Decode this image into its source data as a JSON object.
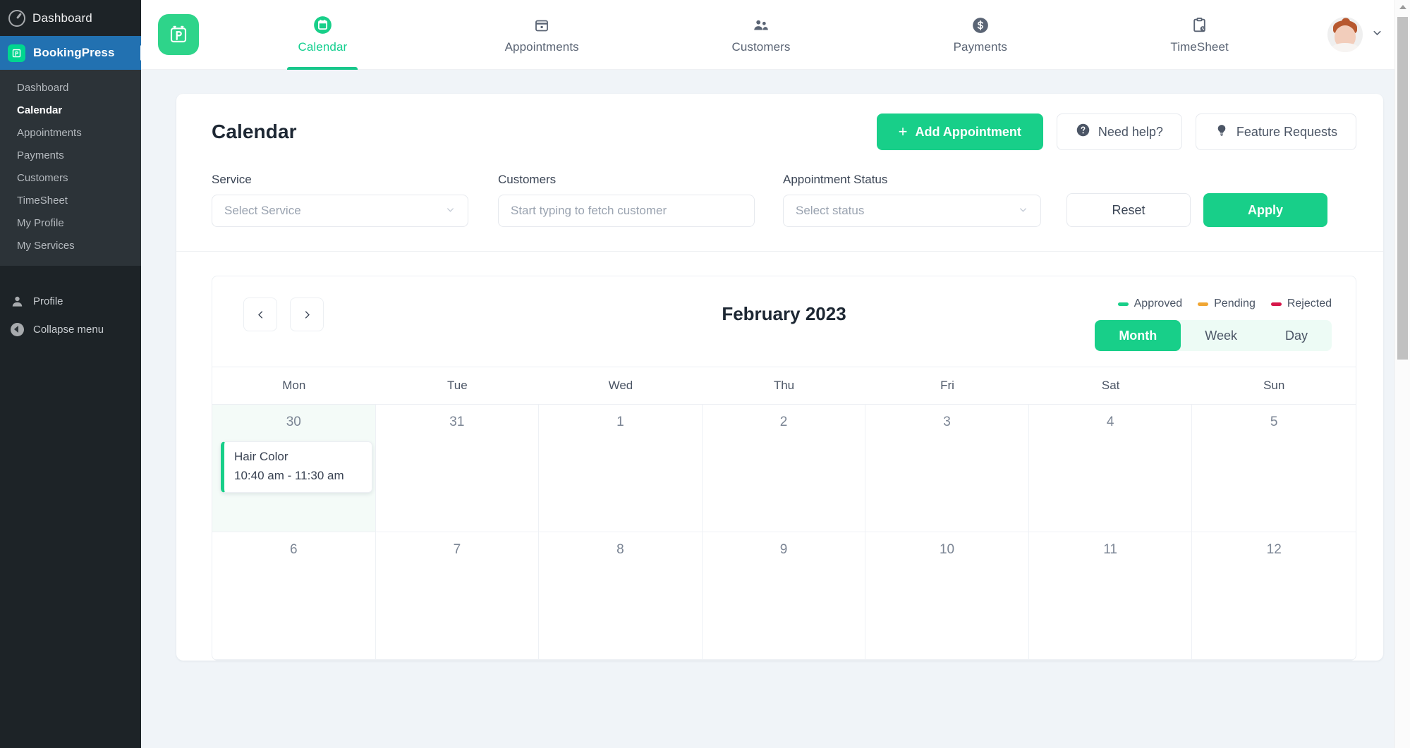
{
  "wp_admin": {
    "adminbar": {
      "label": "Dashboard",
      "icon": "dashboard-icon"
    },
    "brand": {
      "label": "BookingPress",
      "icon": "bookingpress-logo-icon"
    },
    "submenu": [
      {
        "label": "Dashboard",
        "current": false
      },
      {
        "label": "Calendar",
        "current": true
      },
      {
        "label": "Appointments",
        "current": false
      },
      {
        "label": "Payments",
        "current": false
      },
      {
        "label": "Customers",
        "current": false
      },
      {
        "label": "TimeSheet",
        "current": false
      },
      {
        "label": "My Profile",
        "current": false
      },
      {
        "label": "My Services",
        "current": false
      }
    ],
    "bottom": [
      {
        "label": "Profile",
        "icon": "user-icon"
      },
      {
        "label": "Collapse menu",
        "icon": "collapse-left-icon"
      }
    ]
  },
  "topnav": {
    "logo_icon": "bookingpress-app-logo",
    "items": [
      {
        "label": "Calendar",
        "icon": "calendar-filled-icon",
        "active": true
      },
      {
        "label": "Appointments",
        "icon": "calendar-outline-icon",
        "active": false
      },
      {
        "label": "Customers",
        "icon": "people-icon",
        "active": false
      },
      {
        "label": "Payments",
        "icon": "dollar-coin-icon",
        "active": false
      },
      {
        "label": "TimeSheet",
        "icon": "clipboard-clock-icon",
        "active": false
      }
    ],
    "avatar": {
      "name": "avatar",
      "chevron": "chevron-down-icon"
    }
  },
  "page": {
    "title": "Calendar",
    "actions": [
      {
        "label": "Add Appointment",
        "style": "primary",
        "icon": "plus-icon"
      },
      {
        "label": "Need help?",
        "style": "ghost",
        "icon": "question-circle-icon"
      },
      {
        "label": "Feature Requests",
        "style": "ghost",
        "icon": "lightbulb-icon"
      }
    ]
  },
  "filters": {
    "service": {
      "label": "Service",
      "value": "Select Service",
      "chevron": "chevron-down-icon"
    },
    "customers": {
      "label": "Customers",
      "value": "",
      "placeholder": "Start typing to fetch customer"
    },
    "status": {
      "label": "Appointment Status",
      "value": "Select status",
      "chevron": "chevron-down-icon"
    },
    "reset_label": "Reset",
    "apply_label": "Apply"
  },
  "calendar": {
    "prev_icon": "chevron-left-icon",
    "next_icon": "chevron-right-icon",
    "title": "February 2023",
    "legend": [
      {
        "label": "Approved",
        "color": "#18cf89"
      },
      {
        "label": "Pending",
        "color": "#f0a633"
      },
      {
        "label": "Rejected",
        "color": "#d6174a"
      }
    ],
    "views": [
      {
        "label": "Month",
        "active": true
      },
      {
        "label": "Week",
        "active": false
      },
      {
        "label": "Day",
        "active": false
      }
    ],
    "weekdays": [
      "Mon",
      "Tue",
      "Wed",
      "Thu",
      "Fri",
      "Sat",
      "Sun"
    ],
    "weeks": [
      {
        "days": [
          {
            "num": "30",
            "today": true,
            "events": [
              {
                "title": "Hair Color",
                "time": "10:40 am - 11:30 am",
                "status_color": "#18cf89"
              }
            ]
          },
          {
            "num": "31",
            "today": false,
            "events": []
          },
          {
            "num": "1",
            "today": false,
            "events": []
          },
          {
            "num": "2",
            "today": false,
            "events": []
          },
          {
            "num": "3",
            "today": false,
            "events": []
          },
          {
            "num": "4",
            "today": false,
            "events": []
          },
          {
            "num": "5",
            "today": false,
            "events": []
          }
        ]
      },
      {
        "days": [
          {
            "num": "6",
            "today": false,
            "events": []
          },
          {
            "num": "7",
            "today": false,
            "events": []
          },
          {
            "num": "8",
            "today": false,
            "events": []
          },
          {
            "num": "9",
            "today": false,
            "events": []
          },
          {
            "num": "10",
            "today": false,
            "events": []
          },
          {
            "num": "11",
            "today": false,
            "events": []
          },
          {
            "num": "12",
            "today": false,
            "events": []
          }
        ]
      }
    ]
  },
  "colors": {
    "brand_green": "#18cf89",
    "wp_blue": "#2271b1",
    "wp_dark": "#1d2327"
  }
}
